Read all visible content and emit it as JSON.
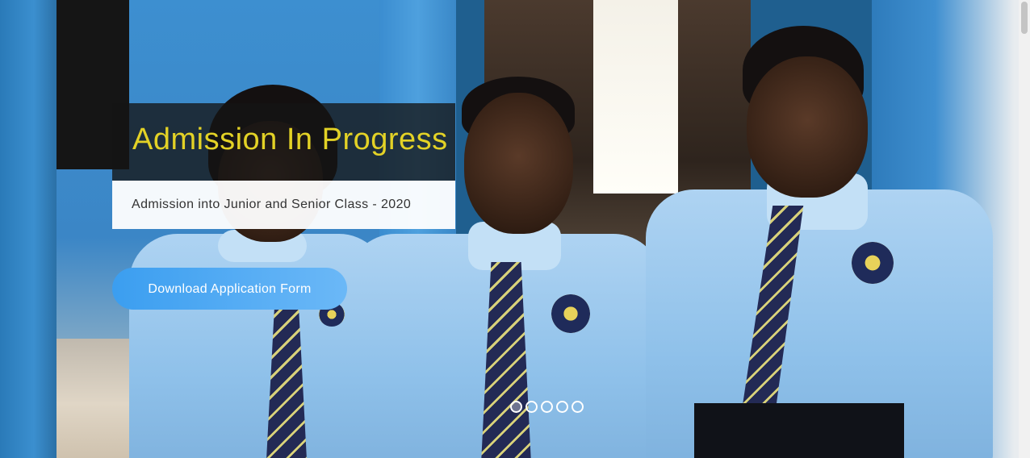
{
  "hero": {
    "title": "Admission In Progress",
    "subtitle": "Admission into Junior and Senior Class - 2020",
    "cta_label": "Download Application Form",
    "title_color": "#e3d226",
    "cta_color": "#3b9ef0"
  },
  "slider": {
    "slide_count": 5,
    "active_index": 0
  }
}
